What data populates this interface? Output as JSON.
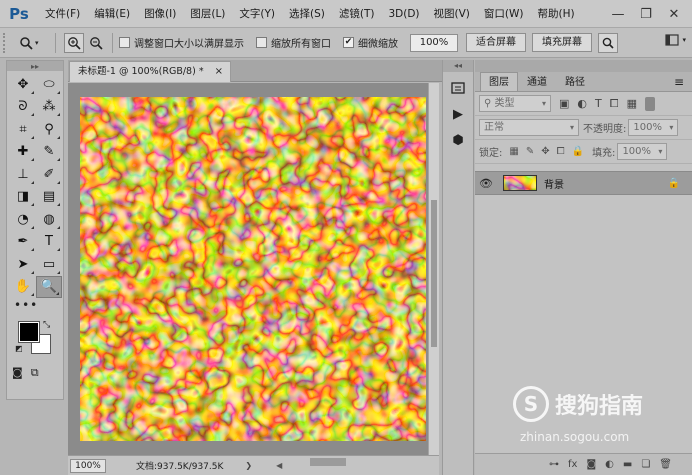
{
  "app": {
    "logo": "Ps"
  },
  "menu": [
    "文件(F)",
    "编辑(E)",
    "图像(I)",
    "图层(L)",
    "文字(Y)",
    "选择(S)",
    "滤镜(T)",
    "3D(D)",
    "视图(V)",
    "窗口(W)",
    "帮助(H)"
  ],
  "window_controls": {
    "minimize": "—",
    "restore": "❐",
    "close": "✕"
  },
  "options": {
    "resize_windows_label": "调整窗口大小以满屏显示",
    "resize_windows_checked": false,
    "zoom_all_windows_label": "缩放所有窗口",
    "zoom_all_windows_checked": false,
    "scrubby_zoom_label": "细微缩放",
    "scrubby_zoom_checked": true,
    "zoom_value": "100%",
    "fit_screen_label": "适合屏幕",
    "fill_screen_label": "填充屏幕"
  },
  "toolbox": {
    "tools": [
      {
        "name": "move-tool",
        "glyph": "✥"
      },
      {
        "name": "marquee-tool",
        "glyph": "⬭"
      },
      {
        "name": "lasso-tool",
        "glyph": "ᘐ"
      },
      {
        "name": "magic-wand-tool",
        "glyph": "⁂"
      },
      {
        "name": "crop-tool",
        "glyph": "⌗"
      },
      {
        "name": "eyedropper-tool",
        "glyph": "⚲"
      },
      {
        "name": "healing-brush-tool",
        "glyph": "✚"
      },
      {
        "name": "brush-tool",
        "glyph": "✎"
      },
      {
        "name": "clone-stamp-tool",
        "glyph": "⊥"
      },
      {
        "name": "history-brush-tool",
        "glyph": "✐"
      },
      {
        "name": "eraser-tool",
        "glyph": "◨"
      },
      {
        "name": "gradient-tool",
        "glyph": "▤"
      },
      {
        "name": "blur-tool",
        "glyph": "◔"
      },
      {
        "name": "dodge-tool",
        "glyph": "◍"
      },
      {
        "name": "pen-tool",
        "glyph": "✒"
      },
      {
        "name": "type-tool",
        "glyph": "T"
      },
      {
        "name": "path-selection-tool",
        "glyph": "➤"
      },
      {
        "name": "rectangle-tool",
        "glyph": "▭"
      },
      {
        "name": "hand-tool",
        "glyph": "✋"
      },
      {
        "name": "zoom-tool",
        "glyph": "🔍"
      }
    ],
    "more": "•••",
    "active_tool": "zoom-tool",
    "fg_color": "#000000",
    "bg_color": "#ffffff"
  },
  "document": {
    "tab_title": "未标题-1 @ 100%(RGB/8) *",
    "tab_close": "×",
    "zoom": "100%",
    "doc_info": "文档:937.5K/937.5K",
    "status_arrow": "❯",
    "scroll_left": "◀"
  },
  "layers_panel": {
    "tabs": [
      "图层",
      "通道",
      "路径"
    ],
    "active_tab": "图层",
    "filter_kind": "类型",
    "blend_mode": "正常",
    "opacity_label": "不透明度:",
    "opacity_value": "100%",
    "lock_label": "锁定:",
    "fill_label": "填充:",
    "fill_value": "100%",
    "layers": [
      {
        "name": "背景",
        "visible": true,
        "locked": true
      }
    ],
    "footer_icons": [
      "link-icon",
      "fx-icon",
      "mask-icon",
      "adjustment-icon",
      "group-icon",
      "new-layer-icon",
      "delete-icon"
    ],
    "footer_glyphs": [
      "⊶",
      "fx",
      "◙",
      "◐",
      "▬",
      "❏",
      "🗑"
    ]
  },
  "watermark": {
    "logo": "S",
    "text": "搜狗指南",
    "url": "zhinan.sogou.com"
  }
}
